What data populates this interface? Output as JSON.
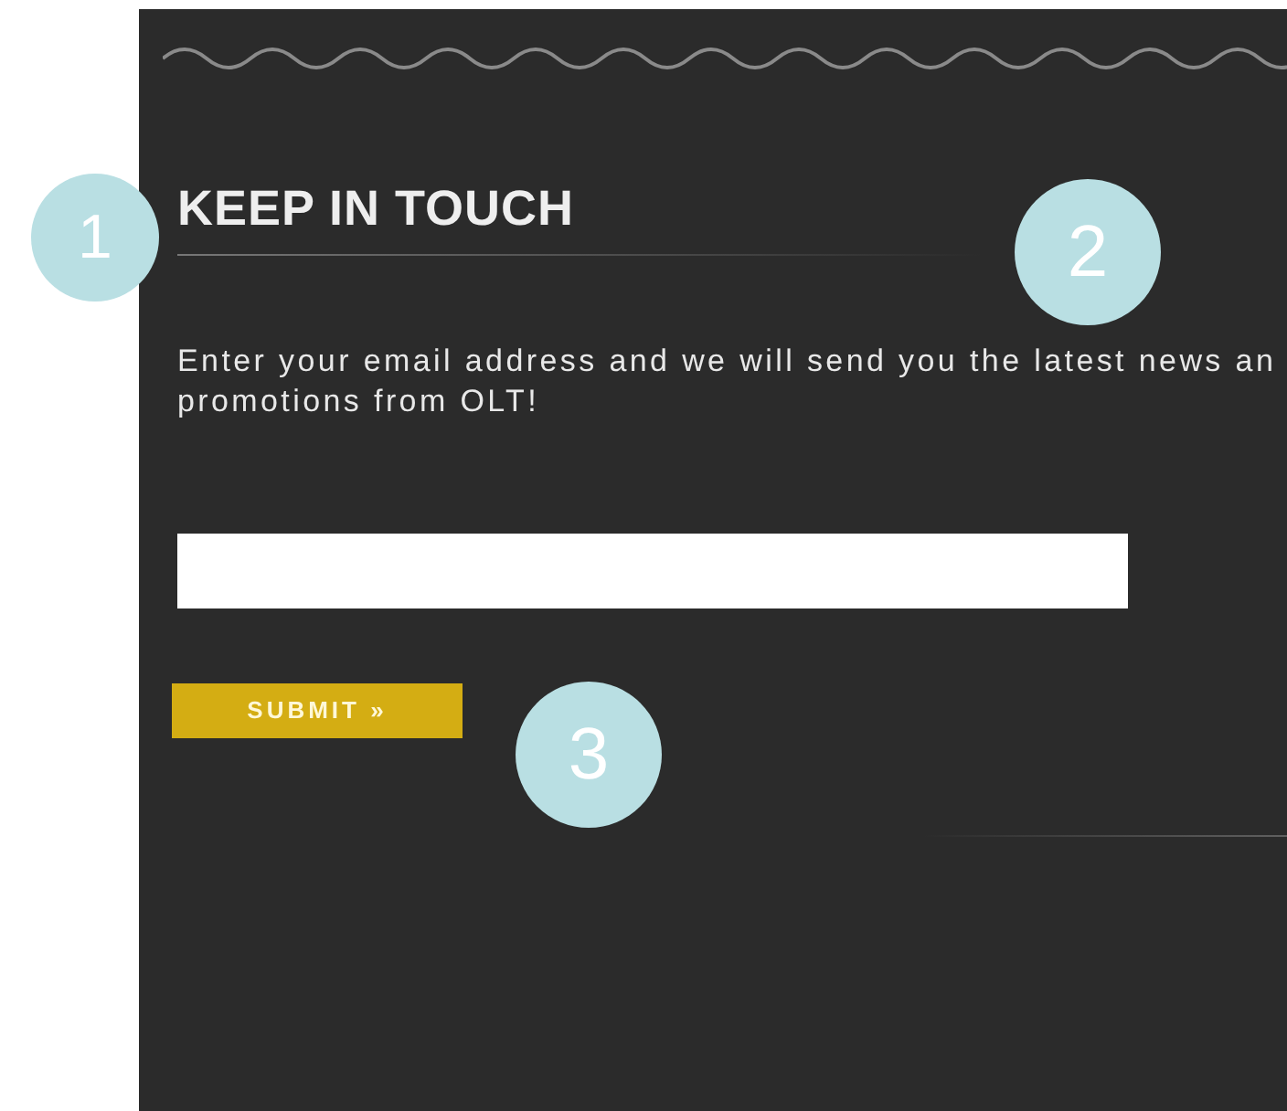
{
  "heading": "KEEP IN TOUCH",
  "intro_lines": [
    "Enter your email address and we will send you the latest news an",
    "promotions from OLT!"
  ],
  "submit_button": "SUBMIT »",
  "callouts": [
    "1",
    "2",
    "3"
  ]
}
